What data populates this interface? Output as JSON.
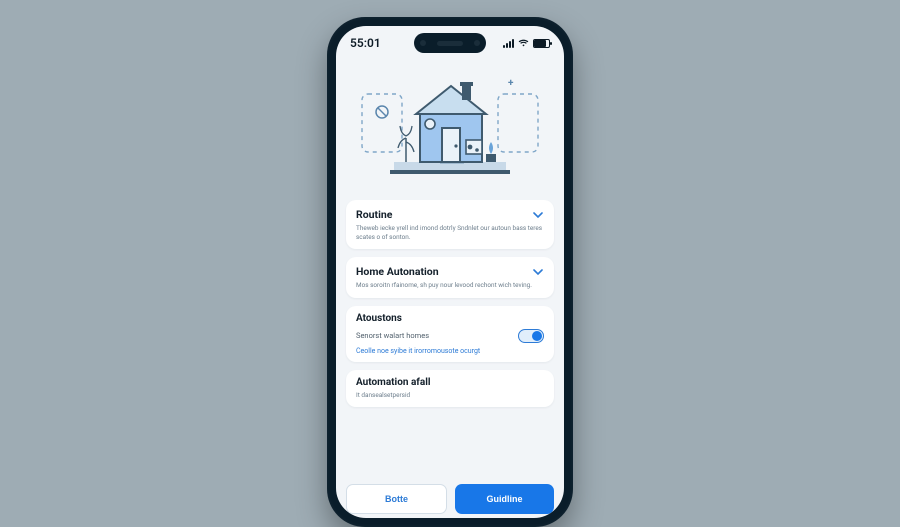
{
  "status": {
    "time": "55:01"
  },
  "hero": {
    "plus": "+"
  },
  "cards": {
    "routine": {
      "title": "Routine",
      "desc": "Theweb iecke yrell ind imond dotrly Sndnlet our autoun bass teres scates o of sonton."
    },
    "homeAutomation": {
      "title": "Home Autonation",
      "desc": "Mos soroitn rfainome, sh puy nour levood rechont wich teving."
    },
    "atoustons": {
      "title": "Atoustons",
      "toggleLabel": "Senorst walart homes",
      "link": "Ceolle noe syibe it irorromousote ocurgt"
    },
    "automationAfall": {
      "title": "Automation afall",
      "desc": "It dansealsetpersid"
    }
  },
  "footer": {
    "secondary": "Botte",
    "primary": "Guidline"
  }
}
